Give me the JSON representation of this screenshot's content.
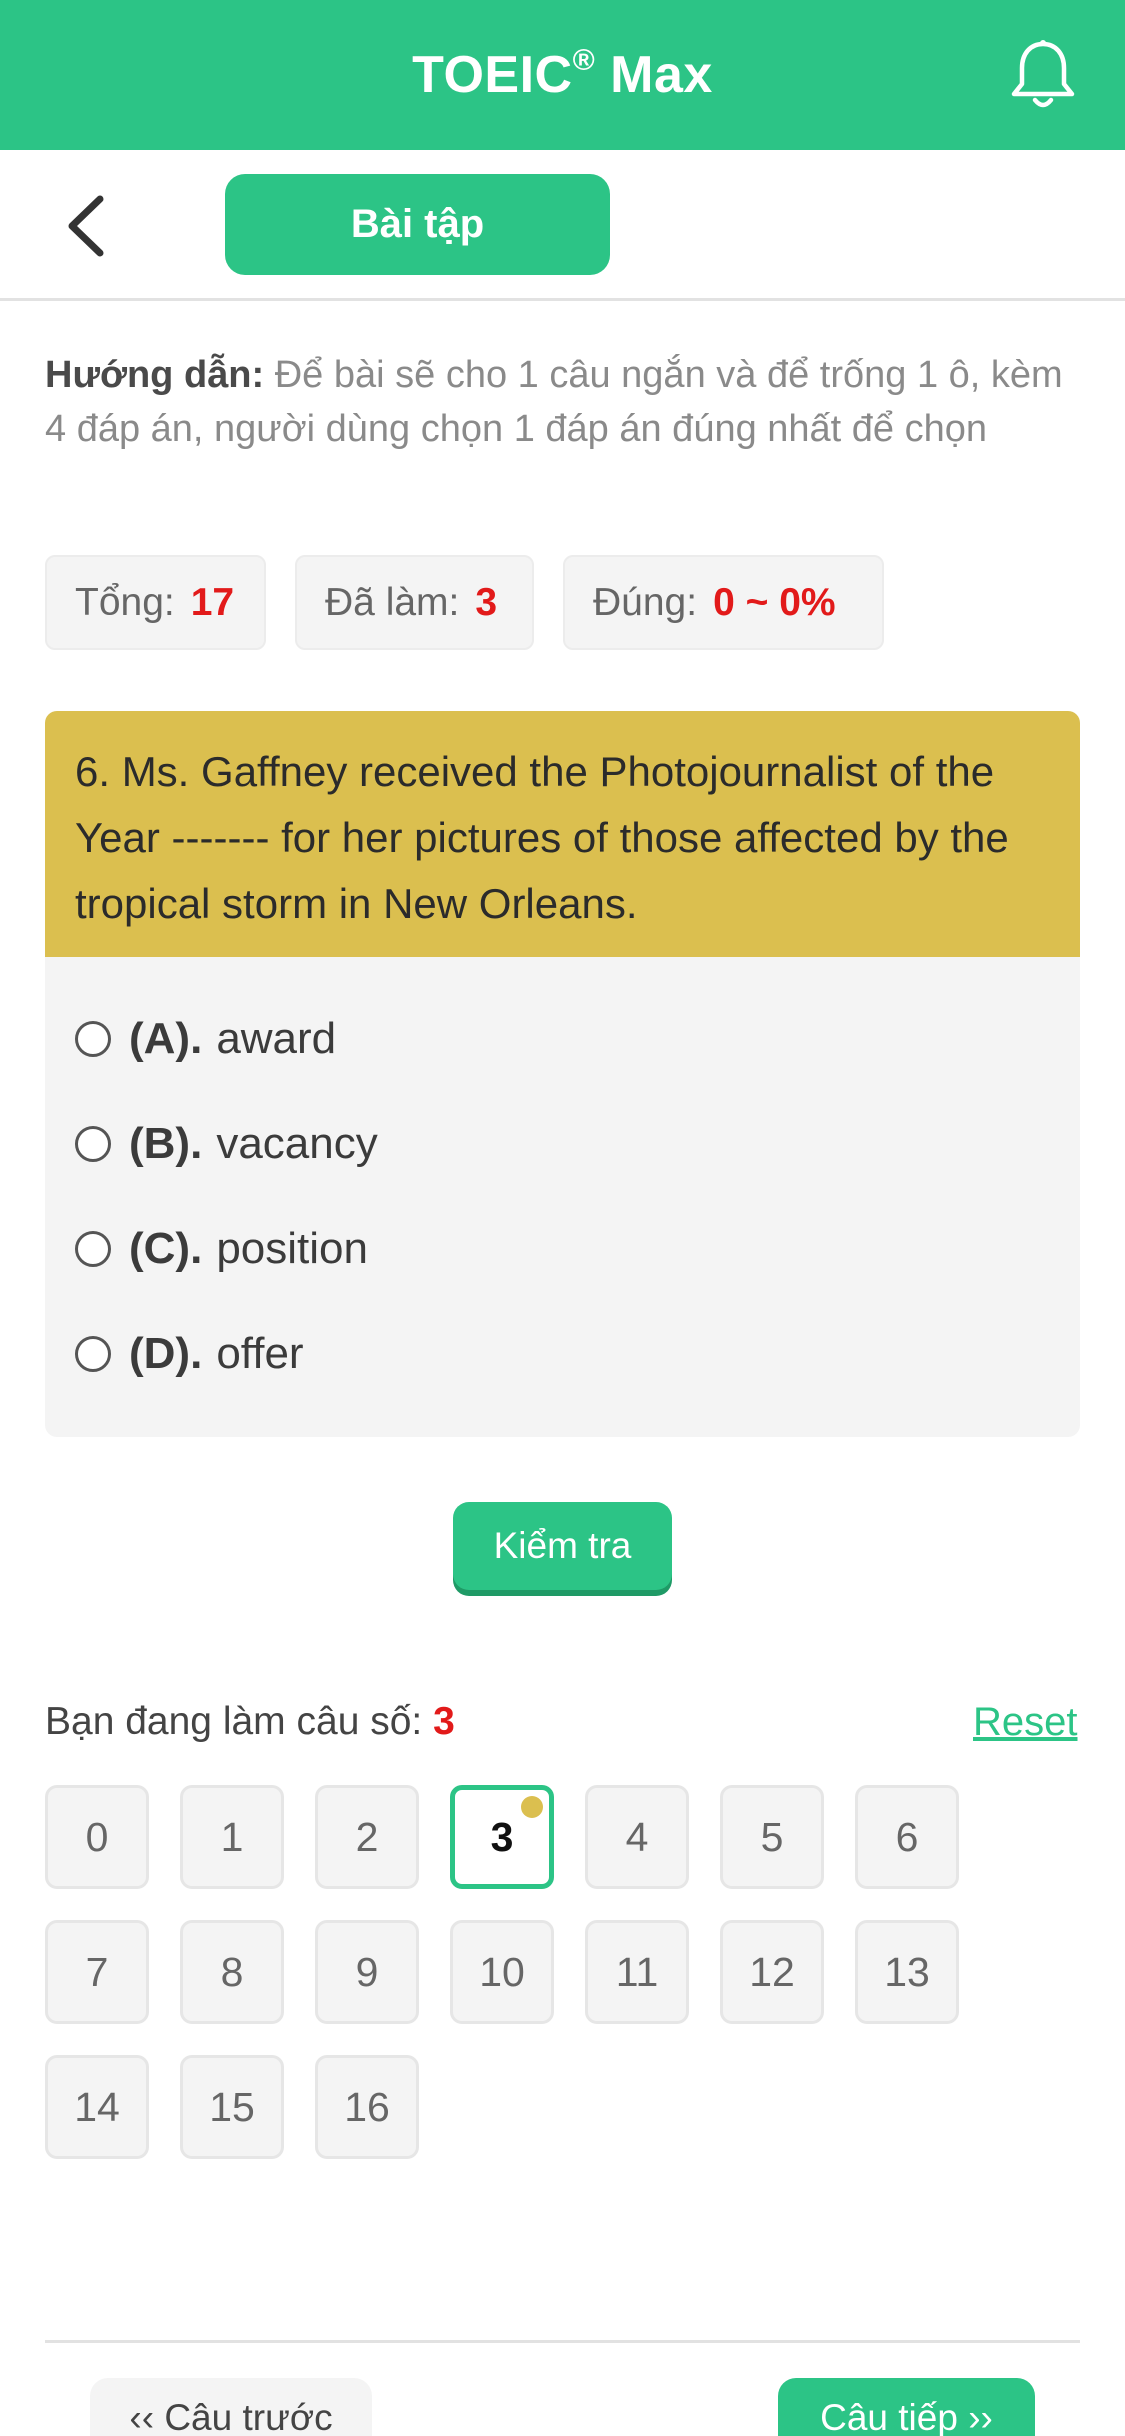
{
  "header": {
    "app_title": "TOEIC",
    "registered_mark": "®",
    "app_title_suffix": " Max",
    "bell_icon": "bell-icon"
  },
  "subheader": {
    "back_icon": "chevron-left-icon",
    "tab_label": "Bài tập"
  },
  "instructions": {
    "label": "Hướng dẫn:",
    "text": " Để bài sẽ cho 1 câu ngắn và để trống 1 ô, kèm 4 đáp án, người dùng chọn 1 đáp án đúng nhất để chọn"
  },
  "stats": {
    "total_label": "Tổng:",
    "total_value": "17",
    "done_label": "Đã làm:",
    "done_value": "3",
    "correct_label": "Đúng:",
    "correct_value": "0 ~ 0%"
  },
  "question": {
    "text": "6. Ms. Gaffney received the Photojournalist of the Year ------- for her pictures of those affected by the tropical storm in New Orleans.",
    "options": [
      {
        "key": "(A).",
        "text": "award"
      },
      {
        "key": "(B).",
        "text": "vacancy"
      },
      {
        "key": "(C).",
        "text": "position"
      },
      {
        "key": "(D).",
        "text": "offer"
      }
    ]
  },
  "check_button": "Kiểm tra",
  "progress": {
    "label": "Bạn đang làm câu số:",
    "current": "3",
    "reset_label": "Reset",
    "numbers": [
      "0",
      "1",
      "2",
      "3",
      "4",
      "5",
      "6",
      "7",
      "8",
      "9",
      "10",
      "11",
      "12",
      "13",
      "14",
      "15",
      "16"
    ],
    "active_index": 3
  },
  "nav": {
    "prev_label": "‹‹ Câu trước",
    "next_label": "Câu tiếp ››"
  },
  "colors": {
    "brand": "#2cc486",
    "question_header": "#dbbf4f",
    "highlight_red": "#e21a1a"
  }
}
